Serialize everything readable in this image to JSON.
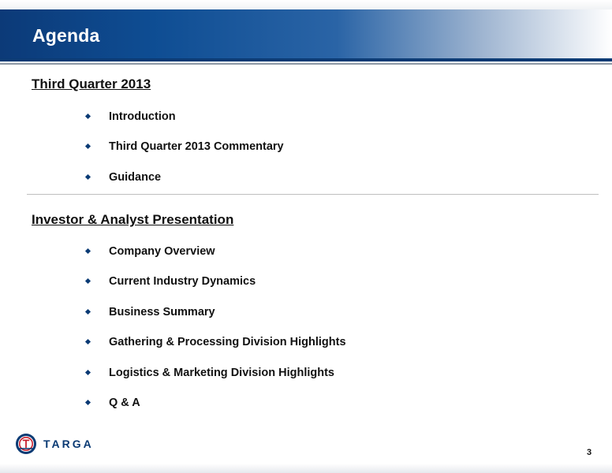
{
  "slide": {
    "title": "Agenda",
    "page_number": "3"
  },
  "sections": [
    {
      "heading": "Third Quarter 2013",
      "items": [
        "Introduction",
        "Third Quarter 2013 Commentary",
        "Guidance"
      ]
    },
    {
      "heading": "Investor & Analyst Presentation",
      "items": [
        "Company Overview",
        "Current Industry Dynamics",
        "Business Summary",
        "Gathering & Processing Division Highlights",
        "Logistics & Marketing Division Highlights",
        "Q & A"
      ]
    }
  ],
  "logo": {
    "wordmark": "TARGA",
    "icon": "targa-emblem-icon"
  },
  "colors": {
    "title_bar_dark": "#0c3a78",
    "accent_blue": "#0a3a74",
    "logo_red": "#c8202f"
  }
}
